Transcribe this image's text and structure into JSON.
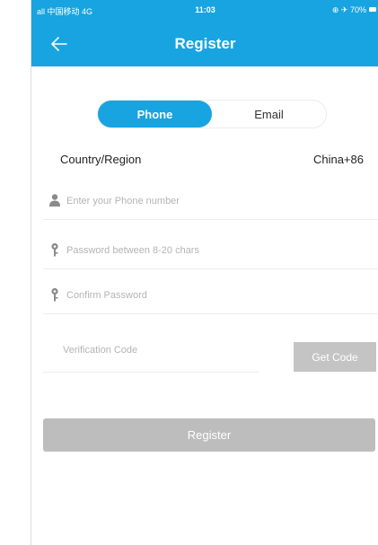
{
  "colors": {
    "accent": "#18a4e0",
    "button_disabled": "#bdbdbd",
    "get_code_bg": "#c4c4c4"
  },
  "status_bar": {
    "carrier": "all 中国移动 4G",
    "time": "11:03",
    "battery": "⊕ ✈ 70%"
  },
  "header": {
    "back_icon": "arrow-left-icon",
    "title": "Register"
  },
  "tabs": {
    "phone_label": "Phone",
    "email_label": "Email",
    "selected": "Phone"
  },
  "country": {
    "label": "Country/Region",
    "value": "China+86"
  },
  "fields": {
    "phone": {
      "icon": "user-icon",
      "placeholder": "Enter your Phone number",
      "value": ""
    },
    "password": {
      "icon": "key-icon",
      "placeholder": "Password between 8-20 chars",
      "value": ""
    },
    "confirm": {
      "icon": "key-icon",
      "placeholder": "Confirm Password",
      "value": ""
    },
    "code": {
      "placeholder": "Verification Code",
      "value": ""
    }
  },
  "get_code_label": "Get Code",
  "register_label": "Register"
}
